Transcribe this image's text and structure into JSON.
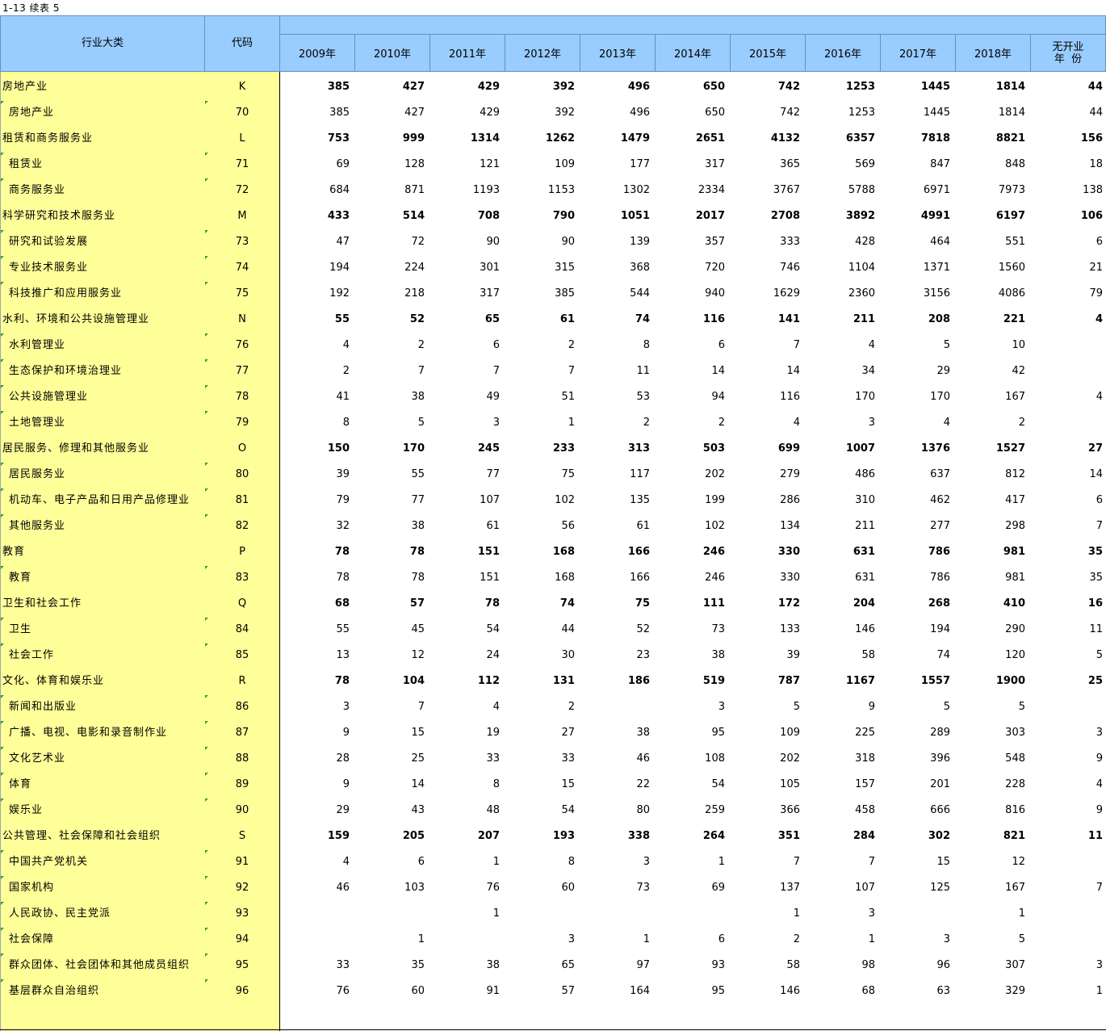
{
  "title": "1-13  续表 5",
  "header": {
    "industry": "行业大类",
    "code": "代码",
    "years": [
      "2009年",
      "2010年",
      "2011年",
      "2012年",
      "2013年",
      "2014年",
      "2015年",
      "2016年",
      "2017年",
      "2018年"
    ],
    "no_year_line1": "无开业",
    "no_year_line2": "年  份"
  },
  "rows": [
    {
      "name": "房地产业",
      "code": "K",
      "level": 0,
      "v": [
        "385",
        "427",
        "429",
        "392",
        "496",
        "650",
        "742",
        "1253",
        "1445",
        "1814",
        "44"
      ]
    },
    {
      "name": "房地产业",
      "code": "70",
      "level": 1,
      "v": [
        "385",
        "427",
        "429",
        "392",
        "496",
        "650",
        "742",
        "1253",
        "1445",
        "1814",
        "44"
      ]
    },
    {
      "name": "租赁和商务服务业",
      "code": "L",
      "level": 0,
      "v": [
        "753",
        "999",
        "1314",
        "1262",
        "1479",
        "2651",
        "4132",
        "6357",
        "7818",
        "8821",
        "156"
      ]
    },
    {
      "name": "租赁业",
      "code": "71",
      "level": 1,
      "v": [
        "69",
        "128",
        "121",
        "109",
        "177",
        "317",
        "365",
        "569",
        "847",
        "848",
        "18"
      ]
    },
    {
      "name": "商务服务业",
      "code": "72",
      "level": 1,
      "v": [
        "684",
        "871",
        "1193",
        "1153",
        "1302",
        "2334",
        "3767",
        "5788",
        "6971",
        "7973",
        "138"
      ]
    },
    {
      "name": "科学研究和技术服务业",
      "code": "M",
      "level": 0,
      "v": [
        "433",
        "514",
        "708",
        "790",
        "1051",
        "2017",
        "2708",
        "3892",
        "4991",
        "6197",
        "106"
      ]
    },
    {
      "name": "研究和试验发展",
      "code": "73",
      "level": 1,
      "v": [
        "47",
        "72",
        "90",
        "90",
        "139",
        "357",
        "333",
        "428",
        "464",
        "551",
        "6"
      ]
    },
    {
      "name": "专业技术服务业",
      "code": "74",
      "level": 1,
      "v": [
        "194",
        "224",
        "301",
        "315",
        "368",
        "720",
        "746",
        "1104",
        "1371",
        "1560",
        "21"
      ]
    },
    {
      "name": "科技推广和应用服务业",
      "code": "75",
      "level": 1,
      "v": [
        "192",
        "218",
        "317",
        "385",
        "544",
        "940",
        "1629",
        "2360",
        "3156",
        "4086",
        "79"
      ]
    },
    {
      "name": "水利、环境和公共设施管理业",
      "code": "N",
      "level": 0,
      "v": [
        "55",
        "52",
        "65",
        "61",
        "74",
        "116",
        "141",
        "211",
        "208",
        "221",
        "4"
      ]
    },
    {
      "name": "水利管理业",
      "code": "76",
      "level": 1,
      "v": [
        "4",
        "2",
        "6",
        "2",
        "8",
        "6",
        "7",
        "4",
        "5",
        "10",
        ""
      ]
    },
    {
      "name": "生态保护和环境治理业",
      "code": "77",
      "level": 1,
      "v": [
        "2",
        "7",
        "7",
        "7",
        "11",
        "14",
        "14",
        "34",
        "29",
        "42",
        ""
      ]
    },
    {
      "name": "公共设施管理业",
      "code": "78",
      "level": 1,
      "v": [
        "41",
        "38",
        "49",
        "51",
        "53",
        "94",
        "116",
        "170",
        "170",
        "167",
        "4"
      ]
    },
    {
      "name": "土地管理业",
      "code": "79",
      "level": 1,
      "v": [
        "8",
        "5",
        "3",
        "1",
        "2",
        "2",
        "4",
        "3",
        "4",
        "2",
        ""
      ]
    },
    {
      "name": "居民服务、修理和其他服务业",
      "code": "O",
      "level": 0,
      "v": [
        "150",
        "170",
        "245",
        "233",
        "313",
        "503",
        "699",
        "1007",
        "1376",
        "1527",
        "27"
      ]
    },
    {
      "name": "居民服务业",
      "code": "80",
      "level": 1,
      "v": [
        "39",
        "55",
        "77",
        "75",
        "117",
        "202",
        "279",
        "486",
        "637",
        "812",
        "14"
      ]
    },
    {
      "name": "机动车、电子产品和日用产品修理业",
      "code": "81",
      "level": 1,
      "v": [
        "79",
        "77",
        "107",
        "102",
        "135",
        "199",
        "286",
        "310",
        "462",
        "417",
        "6"
      ]
    },
    {
      "name": "其他服务业",
      "code": "82",
      "level": 1,
      "v": [
        "32",
        "38",
        "61",
        "56",
        "61",
        "102",
        "134",
        "211",
        "277",
        "298",
        "7"
      ]
    },
    {
      "name": "教育",
      "code": "P",
      "level": 0,
      "v": [
        "78",
        "78",
        "151",
        "168",
        "166",
        "246",
        "330",
        "631",
        "786",
        "981",
        "35"
      ]
    },
    {
      "name": "教育",
      "code": "83",
      "level": 1,
      "v": [
        "78",
        "78",
        "151",
        "168",
        "166",
        "246",
        "330",
        "631",
        "786",
        "981",
        "35"
      ]
    },
    {
      "name": "卫生和社会工作",
      "code": "Q",
      "level": 0,
      "v": [
        "68",
        "57",
        "78",
        "74",
        "75",
        "111",
        "172",
        "204",
        "268",
        "410",
        "16"
      ]
    },
    {
      "name": "卫生",
      "code": "84",
      "level": 1,
      "v": [
        "55",
        "45",
        "54",
        "44",
        "52",
        "73",
        "133",
        "146",
        "194",
        "290",
        "11"
      ]
    },
    {
      "name": "社会工作",
      "code": "85",
      "level": 1,
      "v": [
        "13",
        "12",
        "24",
        "30",
        "23",
        "38",
        "39",
        "58",
        "74",
        "120",
        "5"
      ]
    },
    {
      "name": "文化、体育和娱乐业",
      "code": "R",
      "level": 0,
      "v": [
        "78",
        "104",
        "112",
        "131",
        "186",
        "519",
        "787",
        "1167",
        "1557",
        "1900",
        "25"
      ]
    },
    {
      "name": "新闻和出版业",
      "code": "86",
      "level": 1,
      "v": [
        "3",
        "7",
        "4",
        "2",
        "",
        "3",
        "5",
        "9",
        "5",
        "5",
        ""
      ]
    },
    {
      "name": "广播、电视、电影和录音制作业",
      "code": "87",
      "level": 1,
      "v": [
        "9",
        "15",
        "19",
        "27",
        "38",
        "95",
        "109",
        "225",
        "289",
        "303",
        "3"
      ]
    },
    {
      "name": "文化艺术业",
      "code": "88",
      "level": 1,
      "v": [
        "28",
        "25",
        "33",
        "33",
        "46",
        "108",
        "202",
        "318",
        "396",
        "548",
        "9"
      ]
    },
    {
      "name": "体育",
      "code": "89",
      "level": 1,
      "v": [
        "9",
        "14",
        "8",
        "15",
        "22",
        "54",
        "105",
        "157",
        "201",
        "228",
        "4"
      ]
    },
    {
      "name": "娱乐业",
      "code": "90",
      "level": 1,
      "v": [
        "29",
        "43",
        "48",
        "54",
        "80",
        "259",
        "366",
        "458",
        "666",
        "816",
        "9"
      ]
    },
    {
      "name": "公共管理、社会保障和社会组织",
      "code": "S",
      "level": 0,
      "v": [
        "159",
        "205",
        "207",
        "193",
        "338",
        "264",
        "351",
        "284",
        "302",
        "821",
        "11"
      ]
    },
    {
      "name": "中国共产党机关",
      "code": "91",
      "level": 1,
      "v": [
        "4",
        "6",
        "1",
        "8",
        "3",
        "1",
        "7",
        "7",
        "15",
        "12",
        ""
      ]
    },
    {
      "name": "国家机构",
      "code": "92",
      "level": 1,
      "v": [
        "46",
        "103",
        "76",
        "60",
        "73",
        "69",
        "137",
        "107",
        "125",
        "167",
        "7"
      ]
    },
    {
      "name": "人民政协、民主党派",
      "code": "93",
      "level": 1,
      "v": [
        "",
        "",
        "1",
        "",
        "",
        "",
        "1",
        "3",
        "",
        "1",
        ""
      ]
    },
    {
      "name": "社会保障",
      "code": "94",
      "level": 1,
      "v": [
        "",
        "1",
        "",
        "3",
        "1",
        "6",
        "2",
        "1",
        "3",
        "5",
        ""
      ]
    },
    {
      "name": "群众团体、社会团体和其他成员组织",
      "code": "95",
      "level": 1,
      "v": [
        "33",
        "35",
        "38",
        "65",
        "97",
        "93",
        "58",
        "98",
        "96",
        "307",
        "3"
      ]
    },
    {
      "name": "基层群众自治组织",
      "code": "96",
      "level": 1,
      "v": [
        "76",
        "60",
        "91",
        "57",
        "164",
        "95",
        "146",
        "68",
        "63",
        "329",
        "1"
      ]
    }
  ]
}
